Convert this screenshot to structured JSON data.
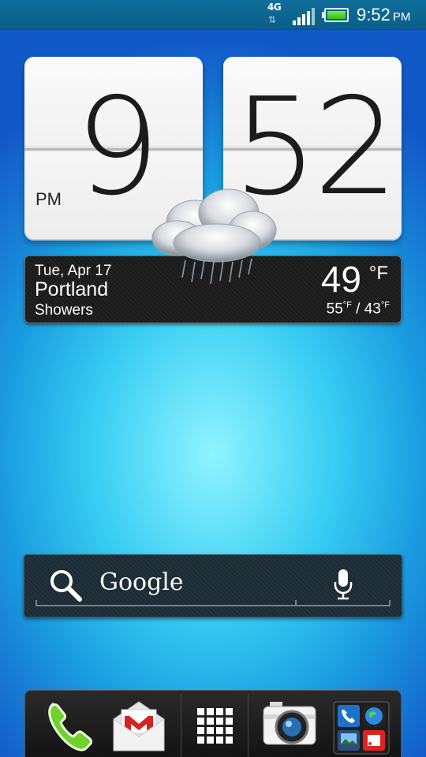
{
  "status_bar": {
    "network": "4G",
    "time": "9:52",
    "ampm": "PM",
    "icons": [
      "4g-data-icon",
      "signal-icon",
      "battery-icon"
    ]
  },
  "clock": {
    "hour": "9",
    "minute": "52",
    "ampm": "PM"
  },
  "weather": {
    "date": "Tue, Apr 17",
    "city": "Portland",
    "condition": "Showers",
    "temp": "49",
    "unit": "°F",
    "high": "55",
    "low": "43",
    "deg_unit": "°F",
    "separator": "/",
    "icon": "rain-cloud-icon"
  },
  "search": {
    "label": "Google"
  },
  "dock": {
    "items": [
      "phone-icon",
      "gmail-icon",
      "all-apps-icon",
      "camera-icon",
      "app-folder-icon"
    ]
  },
  "colors": {
    "wallpaper_center": "#8ff4ff",
    "wallpaper_edge": "#1259c8",
    "status_bar": "#0e6f9a",
    "battery_fill": "#2fbf12"
  }
}
